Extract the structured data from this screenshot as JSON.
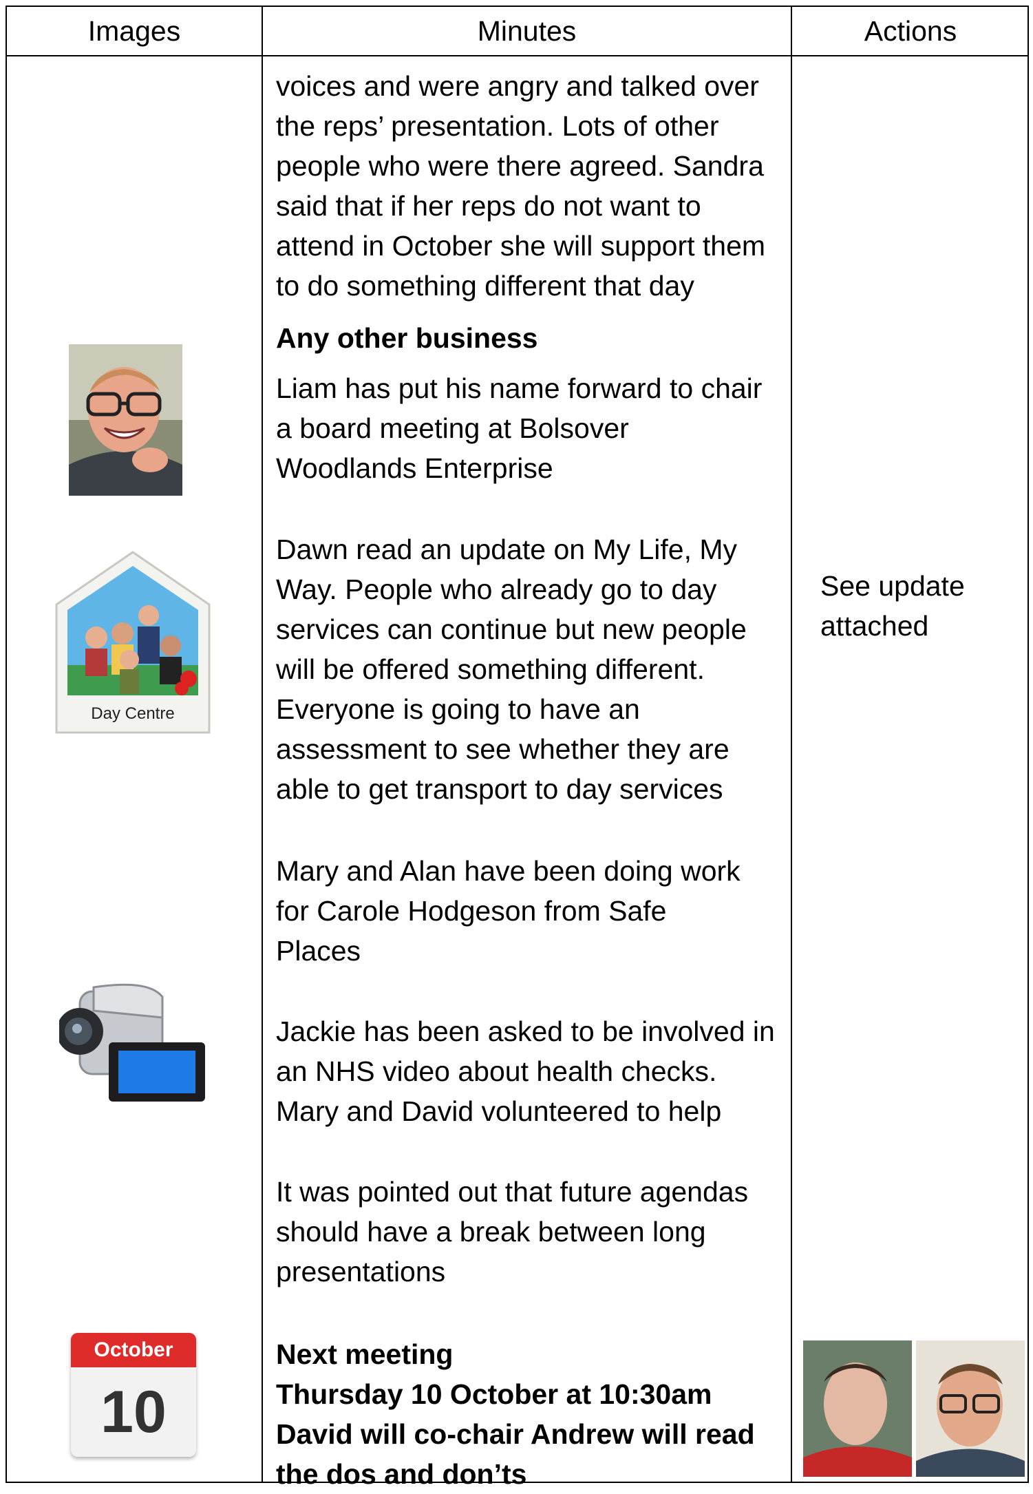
{
  "headers": {
    "images": "Images",
    "minutes": "Minutes",
    "actions": "Actions"
  },
  "minutes": {
    "p1": [
      "voices and were angry and talked over",
      "the reps’ presentation. Lots of other",
      "people who were there agreed. Sandra",
      "said that if her reps do not want to",
      "attend in October she will support them",
      "to do something  different that day"
    ],
    "aob_heading": "Any other business",
    "p2": [
      "Liam has put his name forward to chair",
      "a board meeting at Bolsover",
      "Woodlands Enterprise"
    ],
    "p3": [
      "Dawn read an update on My Life, My",
      "Way. People who already go to day",
      "services can continue but new people",
      "will be offered something different.",
      "Everyone is going to have an",
      "assessment to see whether they are",
      "able to get transport to day services"
    ],
    "p4": [
      "Mary and Alan have been doing work",
      "for Carole Hodgeson from Safe",
      "Places"
    ],
    "p5": [
      "Jackie has been asked to be involved in",
      "an NHS video about health checks.",
      "Mary and David volunteered to help"
    ],
    "p6": [
      "It was pointed out that future agendas",
      "should have a break between long",
      "presentations"
    ],
    "next": [
      "Next meeting",
      "Thursday 10 October at 10:30am",
      "David will co-chair Andrew will read",
      "the dos and don’ts"
    ]
  },
  "actions": {
    "update": [
      "See update",
      "attached"
    ]
  },
  "images": {
    "person_icon": "man-portrait-icon",
    "day_centre_label": "Day Centre",
    "camera_icon": "camcorder-icon",
    "calendar_month": "October",
    "calendar_day": "10",
    "calendar_color": "#e02b2b",
    "people_icon": "two-men-portrait-icon"
  }
}
